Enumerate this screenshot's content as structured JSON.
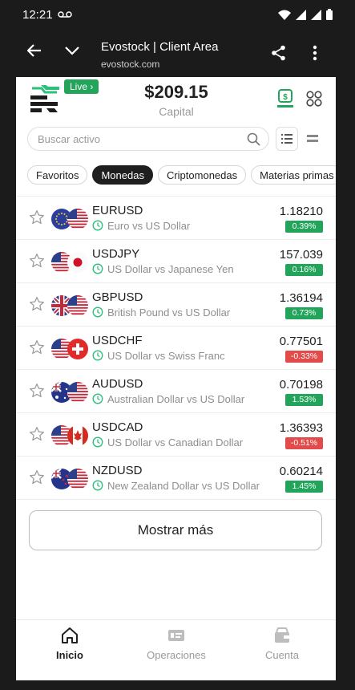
{
  "status_bar": {
    "time": "12:21"
  },
  "browser": {
    "title": "Evostock | Client Area",
    "url": "evostock.com"
  },
  "header": {
    "live_badge": "Live ›",
    "capital_amount": "$209.15",
    "capital_label": "Capital"
  },
  "search": {
    "placeholder": "Buscar activo"
  },
  "filters": [
    "Favoritos",
    "Monedas",
    "Criptomonedas",
    "Materias primas"
  ],
  "active_filter": "Monedas",
  "instruments": [
    {
      "symbol": "EURUSD",
      "description": "Euro vs US Dollar",
      "price": "1.18210",
      "change": "0.39%",
      "direction": "up",
      "flags": [
        "eu",
        "us"
      ]
    },
    {
      "symbol": "USDJPY",
      "description": "US Dollar vs Japanese Yen",
      "price": "157.039",
      "change": "0.16%",
      "direction": "up",
      "flags": [
        "us",
        "jp"
      ]
    },
    {
      "symbol": "GBPUSD",
      "description": "British Pound vs US Dollar",
      "price": "1.36194",
      "change": "0.73%",
      "direction": "up",
      "flags": [
        "gb",
        "us"
      ]
    },
    {
      "symbol": "USDCHF",
      "description": "US Dollar vs Swiss Franc",
      "price": "0.77501",
      "change": "-0.33%",
      "direction": "down",
      "flags": [
        "us",
        "ch"
      ]
    },
    {
      "symbol": "AUDUSD",
      "description": "Australian Dollar vs US Dollar",
      "price": "0.70198",
      "change": "1.53%",
      "direction": "up",
      "flags": [
        "au",
        "us"
      ]
    },
    {
      "symbol": "USDCAD",
      "description": "US Dollar vs Canadian Dollar",
      "price": "1.36393",
      "change": "-0.51%",
      "direction": "down",
      "flags": [
        "us",
        "ca"
      ]
    },
    {
      "symbol": "NZDUSD",
      "description": "New Zealand Dollar vs US Dollar",
      "price": "0.60214",
      "change": "1.45%",
      "direction": "up",
      "flags": [
        "nz",
        "us"
      ]
    }
  ],
  "show_more": "Mostrar más",
  "bottom_nav": [
    {
      "label": "Inicio",
      "icon": "home-icon",
      "active": true
    },
    {
      "label": "Operaciones",
      "icon": "operations-icon",
      "active": false
    },
    {
      "label": "Cuenta",
      "icon": "wallet-icon",
      "active": false
    }
  ],
  "colors": {
    "positive": "#22a55b",
    "negative": "#e34b4b",
    "live": "#22a55b",
    "chrome": "#1b1b1b"
  }
}
